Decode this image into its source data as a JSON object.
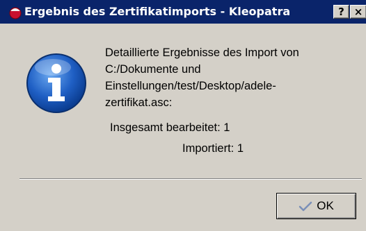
{
  "window": {
    "title": "Ergebnis des Zertifikatimports - Kleopatra",
    "help_label": "?",
    "close_label": "×"
  },
  "message": {
    "line1": "Detaillierte Ergebnisse des Import von",
    "line2": "C:/Dokumente und",
    "line3": "Einstellungen/test/Desktop/adele-",
    "line4": "zertifikat.asc:"
  },
  "results": {
    "total_label": "Insgesamt bearbeitet:",
    "total_value": "1",
    "imported_label": "Importiert:",
    "imported_value": "1"
  },
  "buttons": {
    "ok_label": "OK"
  },
  "icons": {
    "app": "kleopatra-icon",
    "info": "information-icon",
    "ok": "checkmark-icon"
  },
  "colors": {
    "titlebar": "#0a246a",
    "dialog_bg": "#d4d0c8"
  }
}
